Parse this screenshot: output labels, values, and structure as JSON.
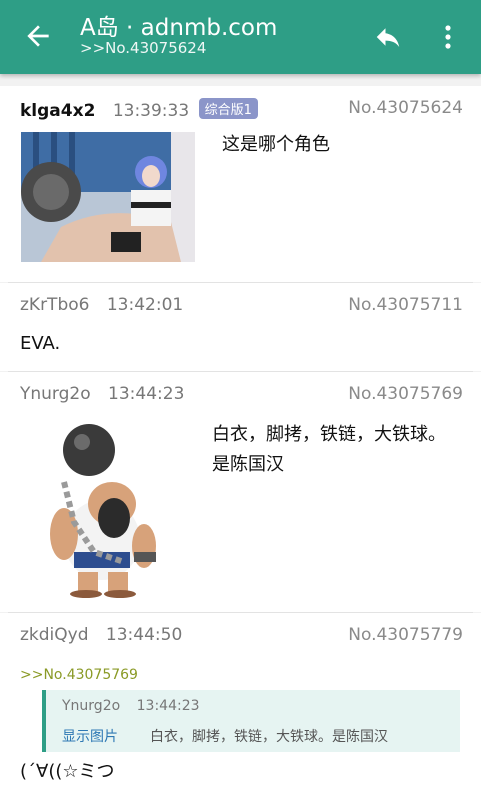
{
  "appbar": {
    "title": "A岛 · adnmb.com",
    "subtitle": ">>No.43075624"
  },
  "posts": [
    {
      "uid": "klga4x2",
      "time": "13:39:33",
      "badge": "综合版1",
      "no": "No.43075624",
      "content": "这是哪个角色"
    },
    {
      "uid": "zKrTbo6",
      "time": "13:42:01",
      "no": "No.43075711",
      "content": "EVA."
    },
    {
      "uid": "Ynurg2o",
      "time": "13:44:23",
      "no": "No.43075769",
      "content": "白衣，脚拷，铁链，大铁球。是陈国汉"
    },
    {
      "uid": "zkdiQyd",
      "time": "13:44:50",
      "no": "No.43075779",
      "quote_link": ">>No.43075769",
      "quote": {
        "uid": "Ynurg2o",
        "time": "13:44:23",
        "show_image": "显示图片",
        "text": "白衣，脚拷，铁链，大铁球。是陈国汉"
      },
      "content": "(´∀((☆ミつ"
    }
  ]
}
